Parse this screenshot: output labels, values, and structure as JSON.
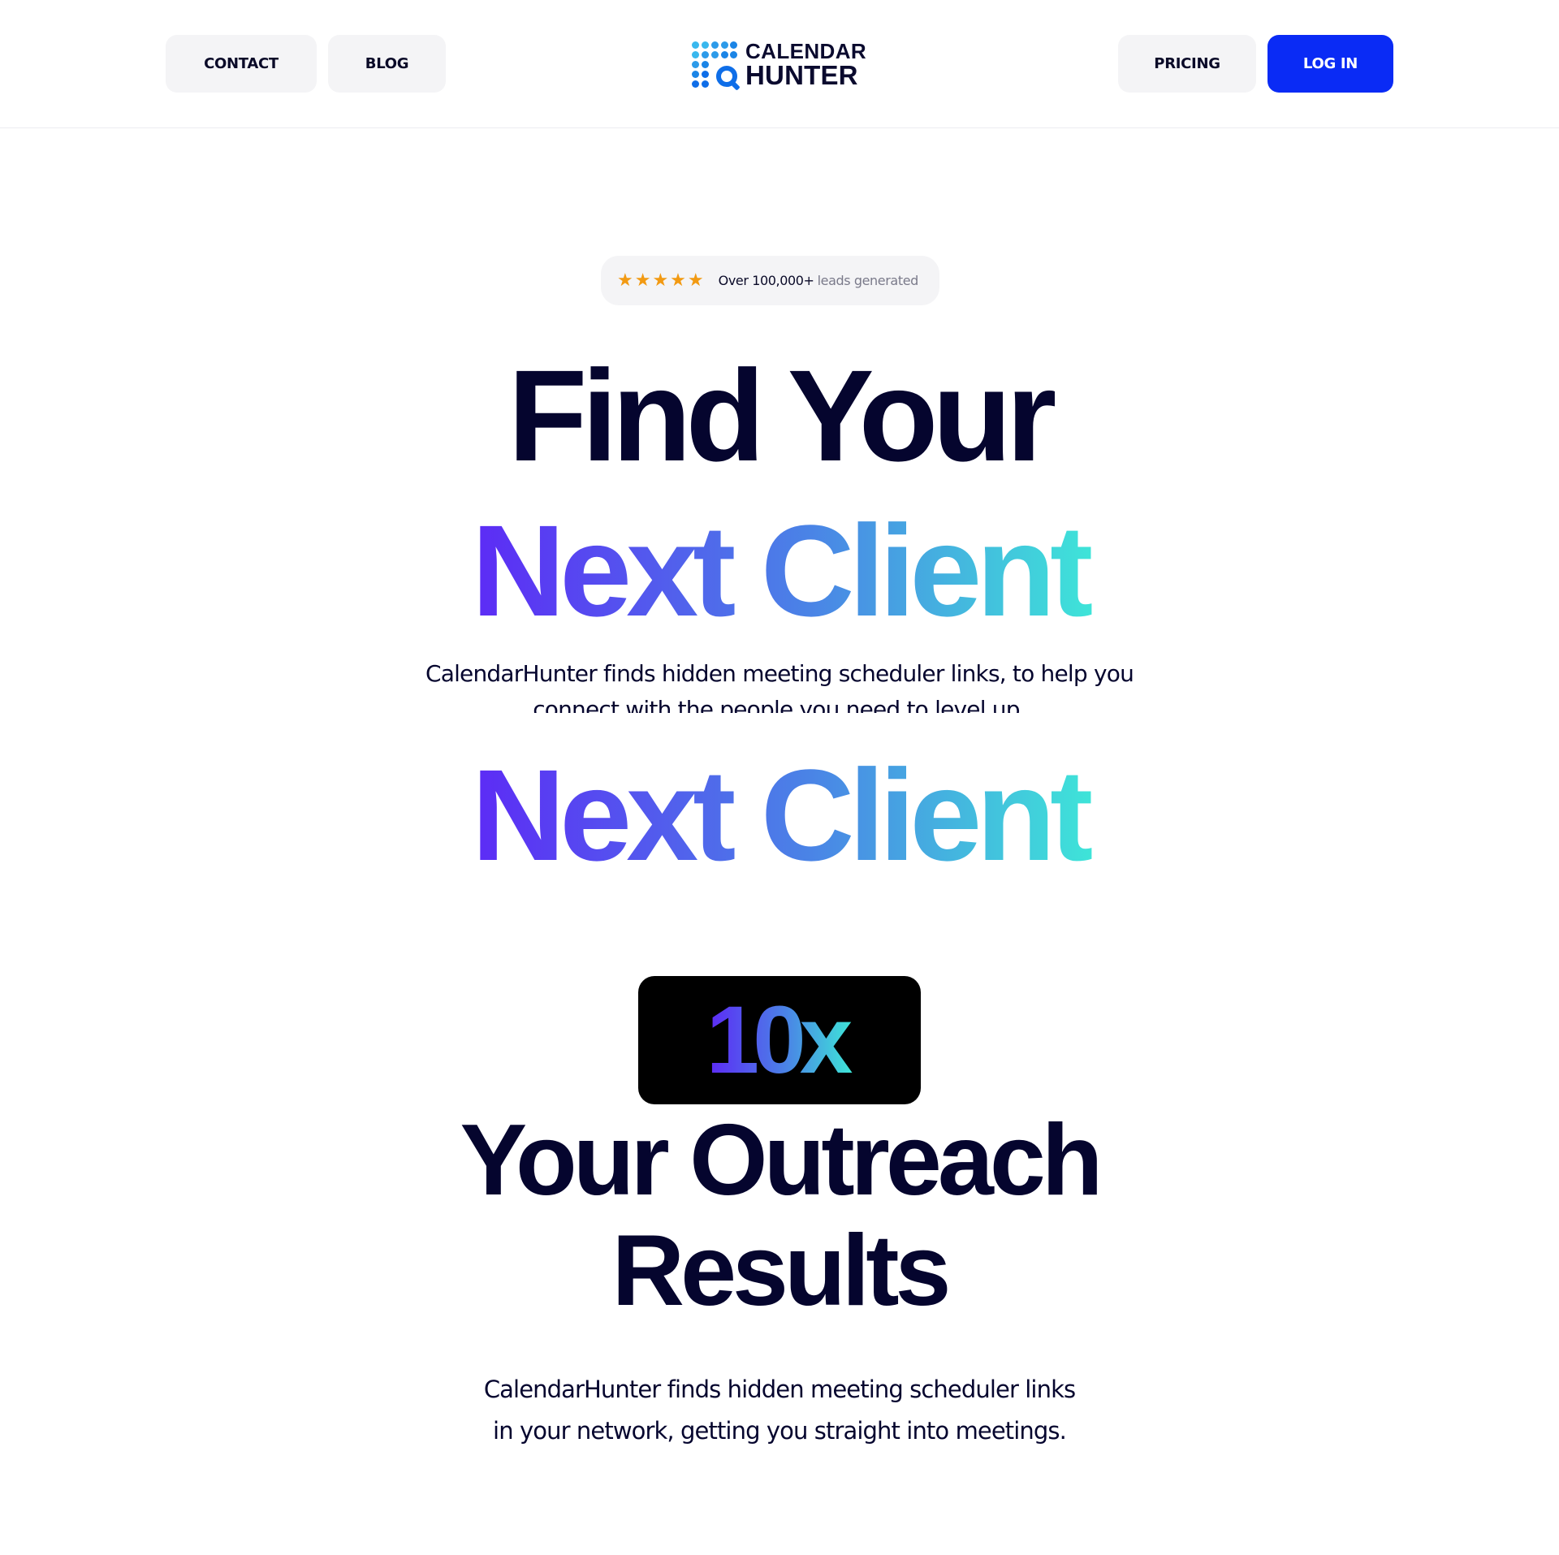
{
  "header": {
    "nav_left": {
      "contact": "CONTACT",
      "blog": "BLOG"
    },
    "logo": {
      "line1": "CALENDAR",
      "line2": "HUNTER"
    },
    "nav_right": {
      "pricing": "PRICING",
      "login": "LOG IN"
    }
  },
  "rating": {
    "stars": "★★★★★",
    "star_count": 5,
    "highlight": "Over 100,000+",
    "muted": "leads generated"
  },
  "hero": {
    "line1": "Find Your",
    "line2": "Next Client",
    "subtitle": "CalendarHunter finds hidden meeting scheduler links, to help you connect with the people you need to level up.",
    "line2_repeat": "Next Client",
    "badge": "10x",
    "line3": "Your Outreach",
    "line4": "Results",
    "bottom_subtitle_1": "CalendarHunter finds hidden meeting scheduler links",
    "bottom_subtitle_2": "in your network, getting you straight into meetings."
  },
  "colors": {
    "brand_blue": "#0a2bf5",
    "gradient_start": "#5d28f6",
    "gradient_end": "#3ee6d8",
    "star": "#f29a13",
    "text_dark": "#05052e"
  },
  "icons": {
    "logo": "calendar-dots-search-icon",
    "star": "star-icon"
  }
}
